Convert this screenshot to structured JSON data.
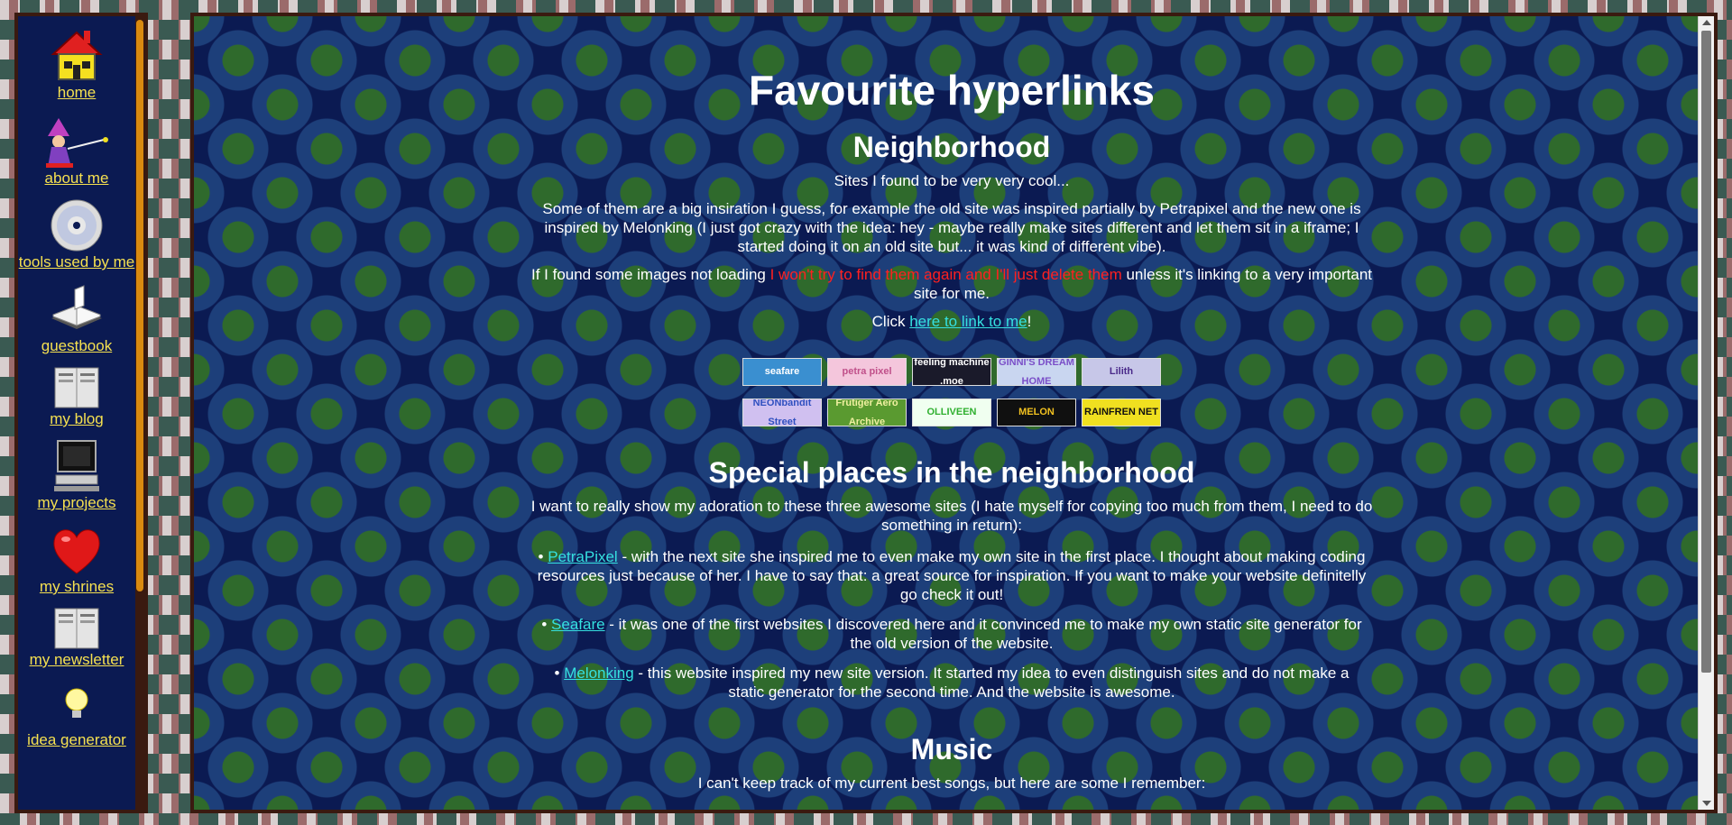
{
  "sidebar": {
    "items": [
      {
        "label": "home",
        "icon": "house-icon"
      },
      {
        "label": "about me",
        "icon": "wizard-icon"
      },
      {
        "label": "tools used by me",
        "icon": "cd-icon"
      },
      {
        "label": "guestbook",
        "icon": "open-book-icon"
      },
      {
        "label": "my blog",
        "icon": "newspaper-icon"
      },
      {
        "label": "my projects",
        "icon": "computer-icon"
      },
      {
        "label": "my shrines",
        "icon": "heart-icon"
      },
      {
        "label": "my newsletter",
        "icon": "newspaper-icon"
      },
      {
        "label": "idea generator",
        "icon": "lightbulb-icon"
      }
    ]
  },
  "main": {
    "title": "Favourite hyperlinks",
    "neighborhood": {
      "heading": "Neighborhood",
      "p1": "Sites I found to be very very cool...",
      "p2": "Some of them are a big insiration I guess, for example the old site was inspired partially by Petrapixel and the new one is inspired by Melonking (I just got crazy with the idea: hey - maybe really make sites different and let them sit in a iframe; I started doing it on an old site but... it was kind of different vibe).",
      "p3_before": "If I found some images not loading ",
      "p3_warning": "I won't try to find them again and I'll just delete them",
      "p3_after": " unless it's linking to a very important site for me.",
      "p4_before": "Click ",
      "p4_link": "here to link to me",
      "p4_after": "!"
    },
    "buttons_row1": [
      {
        "label": "seafare",
        "bg": "#3a8fd0",
        "fg": "#ffffff"
      },
      {
        "label": "petra pixel",
        "bg": "#f4c6dc",
        "fg": "#c0508a"
      },
      {
        "label": "feeling machine .moe",
        "bg": "#1a1a2a",
        "fg": "#ffffff"
      },
      {
        "label": "GINNI'S DREAM HOME",
        "bg": "#c9d6f0",
        "fg": "#7a4fc8"
      },
      {
        "label": "Lilith",
        "bg": "#c7c7e8",
        "fg": "#4a2a8a"
      }
    ],
    "buttons_row2": [
      {
        "label": "NEONbandit Street",
        "bg": "#d0c0f0",
        "fg": "#3050c0"
      },
      {
        "label": "Frutiger Aero Archive",
        "bg": "#5a9a30",
        "fg": "#f0f0a0"
      },
      {
        "label": "OLLIVEEN",
        "bg": "#f0fff0",
        "fg": "#30b030"
      },
      {
        "label": "MELON",
        "bg": "#101010",
        "fg": "#f0c020"
      },
      {
        "label": "RAINFREN NET",
        "bg": "#f0e020",
        "fg": "#101010"
      }
    ],
    "special": {
      "heading": "Special places in the neighborhood",
      "intro": "I want to really show my adoration to these three awesome sites (I hate myself for copying too much from them, I need to do something in return):",
      "items": [
        {
          "link": "PetraPixel",
          "text": " - with the next site she inspired me to even make my own site in the first place. I thought about making coding resources just because of her. I have to say that: a great source for inspiration. If you want to make your website definitelly go check it out!"
        },
        {
          "link": "Seafare",
          "text": " - it was one of the first websites I discovered here and it convinced me to make my own static site generator for the old version of the website."
        },
        {
          "link": "Melonking",
          "text": " - this website inspired my new site version. It started my idea to even distinguish sites and do not make a static generator for the second time. And the website is awesome."
        }
      ]
    },
    "music": {
      "heading": "Music",
      "intro": "I can't keep track of my current best songs, but here are some I remember:"
    }
  }
}
